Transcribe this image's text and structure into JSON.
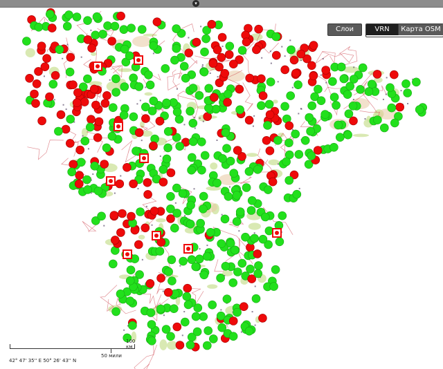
{
  "toolbar": {
    "layers_label": "Слои",
    "vrn_label": "VRN",
    "osm_label": "Карта OSM",
    "active_layer": "VRN"
  },
  "scale": {
    "km_label": "100 км",
    "miles_label": "50 мили"
  },
  "cursor_coords": "42° 47' 35'' E 50° 26' 43'' N",
  "colors": {
    "marker_green": "#22e01c",
    "marker_red": "#ee0a0a",
    "forest": "#cfe3a0",
    "road": "#c8323c",
    "urban": "#e8c9a3"
  },
  "icons": [
    "red-marker-icon",
    "green-marker-icon",
    "settlement-square-icon"
  ]
}
